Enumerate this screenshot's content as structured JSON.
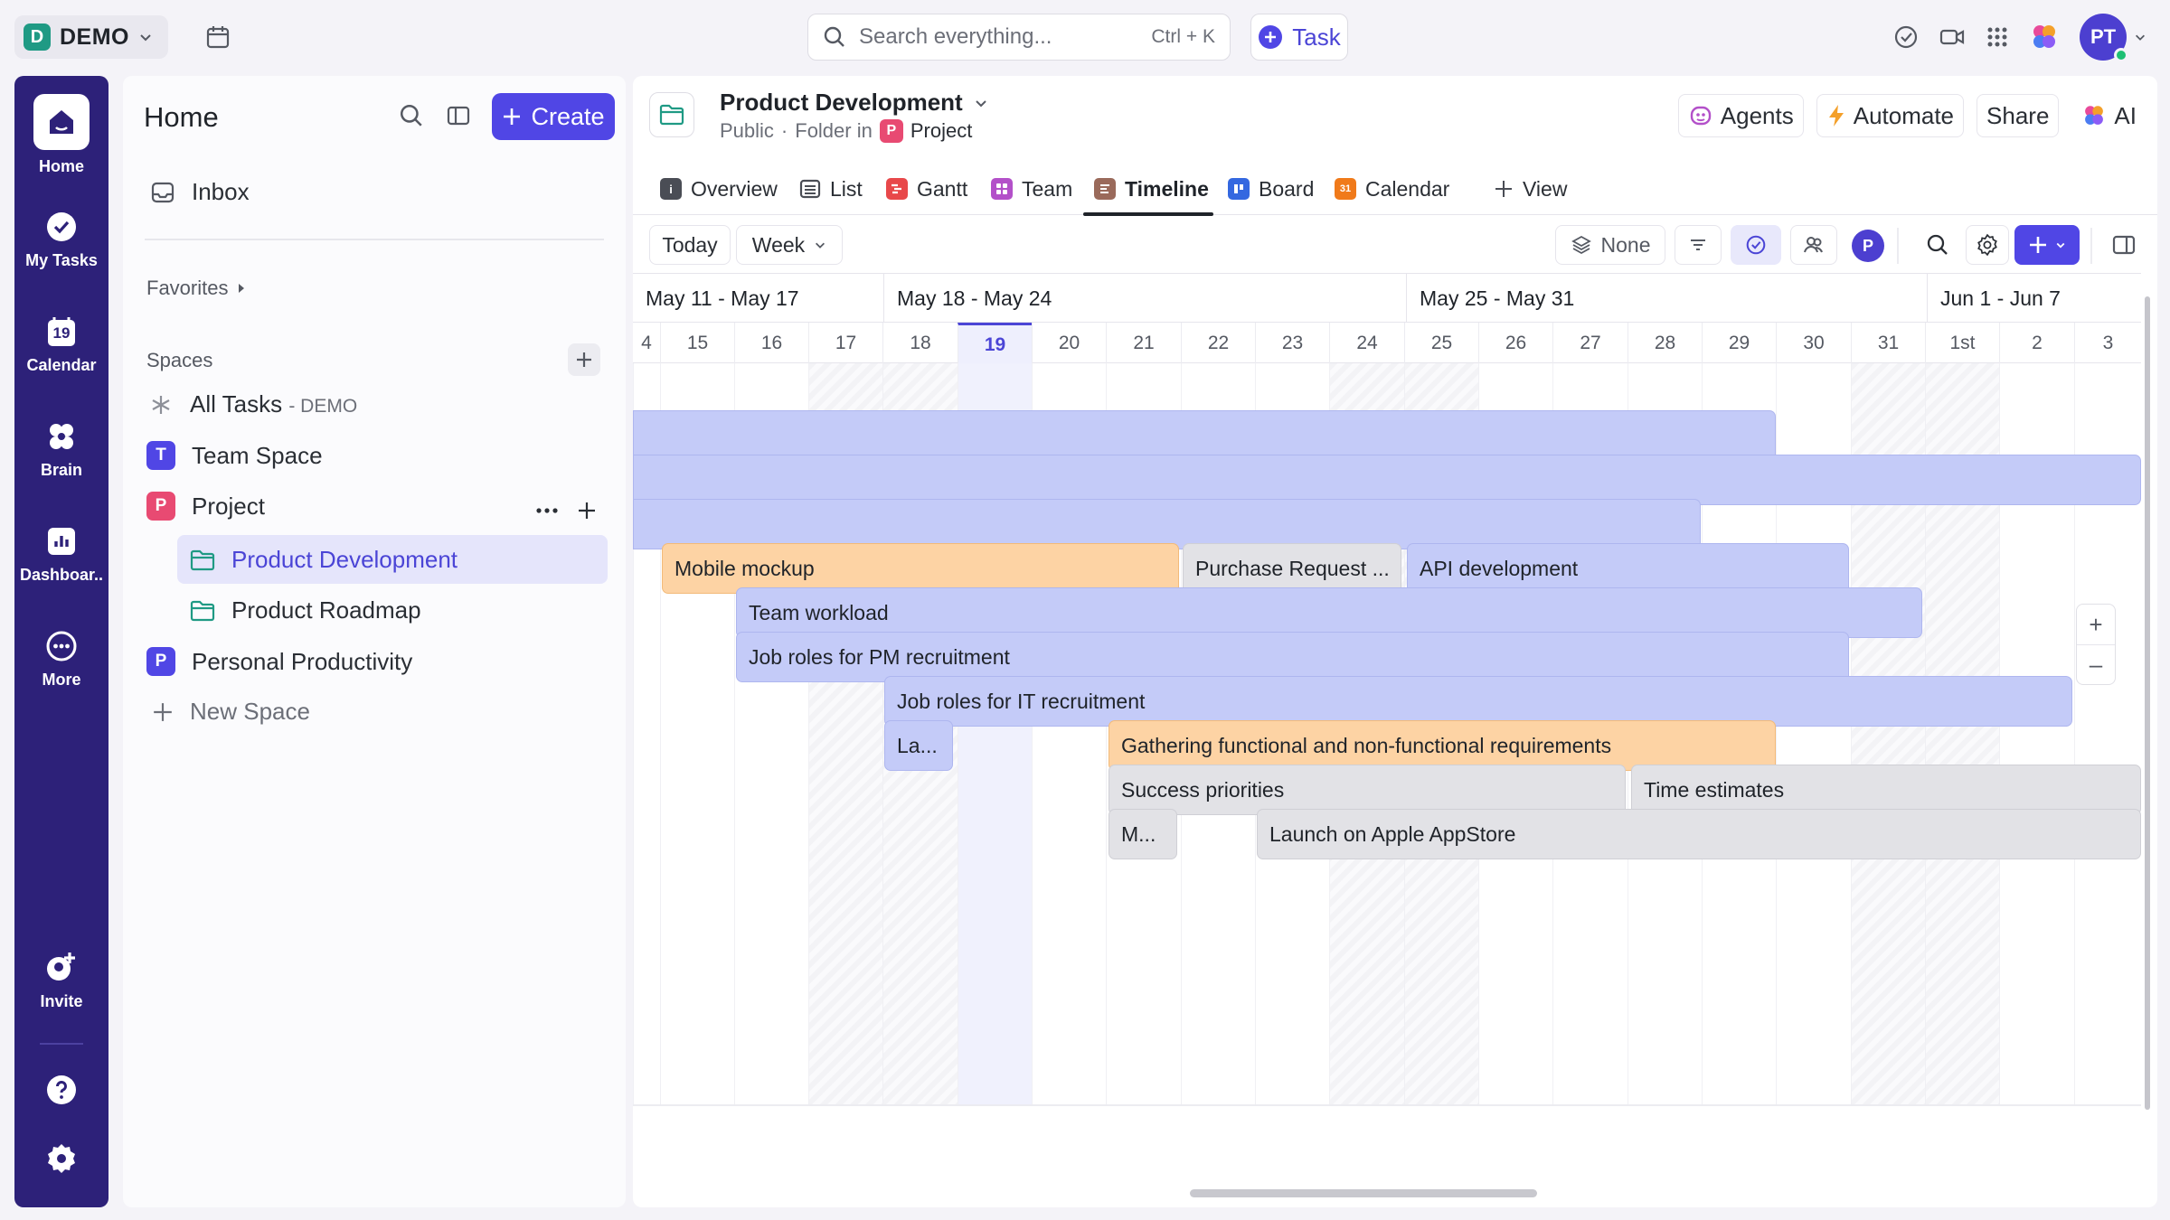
{
  "topbar": {
    "workspace_initial": "D",
    "workspace_name": "DEMO",
    "search_placeholder": "Search everything...",
    "search_shortcut": "Ctrl + K",
    "task_label": "Task",
    "avatar_initials": "PT"
  },
  "rail": {
    "items": [
      {
        "label": "Home",
        "icon": "home-icon"
      },
      {
        "label": "My Tasks",
        "icon": "check-circle-icon"
      },
      {
        "label": "Calendar",
        "icon": "calendar-icon",
        "date": "19"
      },
      {
        "label": "Brain",
        "icon": "brain-icon"
      },
      {
        "label": "Dashboar..",
        "icon": "dashboard-icon"
      },
      {
        "label": "More",
        "icon": "more-icon"
      },
      {
        "label": "Invite",
        "icon": "invite-icon"
      }
    ]
  },
  "sidebar": {
    "title": "Home",
    "create_label": "Create",
    "inbox": "Inbox",
    "favorites": "Favorites",
    "spaces": "Spaces",
    "all_tasks": "All Tasks",
    "all_tasks_suffix": "- DEMO",
    "items": [
      {
        "label": "Team Space",
        "initial": "T",
        "color": "#5046e5"
      },
      {
        "label": "Project",
        "initial": "P",
        "color": "#e84a72"
      },
      {
        "label": "Personal Productivity",
        "initial": "P",
        "color": "#5046e5"
      }
    ],
    "folders": [
      "Product Development",
      "Product Roadmap"
    ],
    "new_space": "New Space"
  },
  "main": {
    "title": "Product Development",
    "sub_public": "Public",
    "sub_folder_in": "Folder in",
    "sub_project_initial": "P",
    "sub_project": "Project",
    "actions": {
      "agents": "Agents",
      "automate": "Automate",
      "share": "Share",
      "ai": "AI"
    },
    "tabs": [
      {
        "label": "Overview",
        "color": "#4a4d55"
      },
      {
        "label": "List",
        "color": "#4a4d55"
      },
      {
        "label": "Gantt",
        "color": "#e8484a"
      },
      {
        "label": "Team",
        "color": "#b350c9"
      },
      {
        "label": "Timeline",
        "color": "#9a6a5b",
        "active": true
      },
      {
        "label": "Board",
        "color": "#3468e0"
      },
      {
        "label": "Calendar",
        "color": "#f07a1a",
        "glyph": "31"
      },
      {
        "label": "View"
      }
    ],
    "toolbar": {
      "today": "Today",
      "week": "Week",
      "none": "None",
      "member_initial": "P"
    }
  },
  "timeline": {
    "weeks": [
      "May 11 - May 17",
      "May 18 - May 24",
      "May 25 - May 31",
      "Jun 1 - Jun 7"
    ],
    "days": [
      "4",
      "15",
      "16",
      "17",
      "18",
      "19",
      "20",
      "21",
      "22",
      "23",
      "24",
      "25",
      "26",
      "27",
      "28",
      "29",
      "30",
      "31",
      "1st",
      "2",
      "3"
    ],
    "today": "19",
    "bars": [
      {
        "label": "",
        "color": "blue"
      },
      {
        "label": "",
        "color": "blue"
      },
      {
        "label": "",
        "color": "blue"
      },
      {
        "label": "Mobile mockup",
        "color": "orange"
      },
      {
        "label": "Purchase Request ...",
        "color": "gray"
      },
      {
        "label": "API development",
        "color": "blue"
      },
      {
        "label": "Team workload",
        "color": "blue"
      },
      {
        "label": "Job roles for PM recruitment",
        "color": "blue"
      },
      {
        "label": "Job roles for IT recruitment",
        "color": "blue"
      },
      {
        "label": "La...",
        "color": "blue"
      },
      {
        "label": "Gathering functional and non-functional requirements",
        "color": "orange"
      },
      {
        "label": "Success priorities",
        "color": "gray"
      },
      {
        "label": "Time estimates",
        "color": "gray"
      },
      {
        "label": "M...",
        "color": "gray"
      },
      {
        "label": "Launch on Apple AppStore",
        "color": "gray"
      }
    ]
  }
}
